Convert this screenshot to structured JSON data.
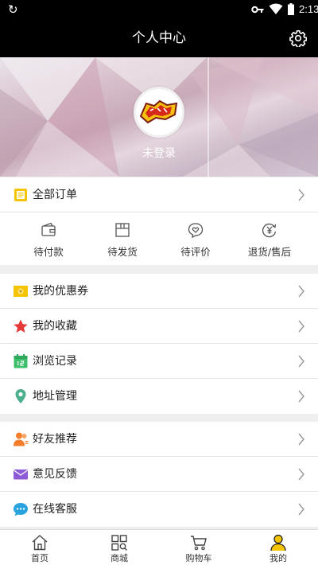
{
  "status_bar": {
    "time": "2:13",
    "icons": [
      "refresh-icon",
      "key-icon",
      "wifi-icon",
      "battery-icon"
    ]
  },
  "header": {
    "title": "个人中心",
    "settings_icon": "gear-icon"
  },
  "profile": {
    "login_text": "未登录",
    "avatar_logo": "logo"
  },
  "orders": {
    "all_label": "全部订单",
    "statuses": [
      {
        "label": "待付款",
        "icon": "wallet-icon"
      },
      {
        "label": "待发货",
        "icon": "box-icon"
      },
      {
        "label": "待评价",
        "icon": "heart-chat-icon"
      },
      {
        "label": "退货/售后",
        "icon": "refund-icon"
      }
    ]
  },
  "menu_group_1": [
    {
      "label": "我的优惠券",
      "icon": "coupon-icon",
      "color": "#f5c400"
    },
    {
      "label": "我的收藏",
      "icon": "star-icon",
      "color": "#e53935"
    },
    {
      "label": "浏览记录",
      "icon": "calendar-icon",
      "color": "#3dbf6b"
    },
    {
      "label": "地址管理",
      "icon": "location-pin-icon",
      "color": "#4caf8e"
    }
  ],
  "menu_group_2": [
    {
      "label": "好友推荐",
      "icon": "friends-icon",
      "color": "#f57c2b"
    },
    {
      "label": "意见反馈",
      "icon": "mail-icon",
      "color": "#8e5bd6"
    },
    {
      "label": "在线客服",
      "icon": "chat-icon",
      "color": "#29a3e0"
    }
  ],
  "tabbar": [
    {
      "label": "首页",
      "icon": "home-icon"
    },
    {
      "label": "商城",
      "icon": "grid-search-icon"
    },
    {
      "label": "购物车",
      "icon": "cart-icon"
    },
    {
      "label": "我的",
      "icon": "user-icon",
      "active_color": "#f5c400"
    }
  ]
}
